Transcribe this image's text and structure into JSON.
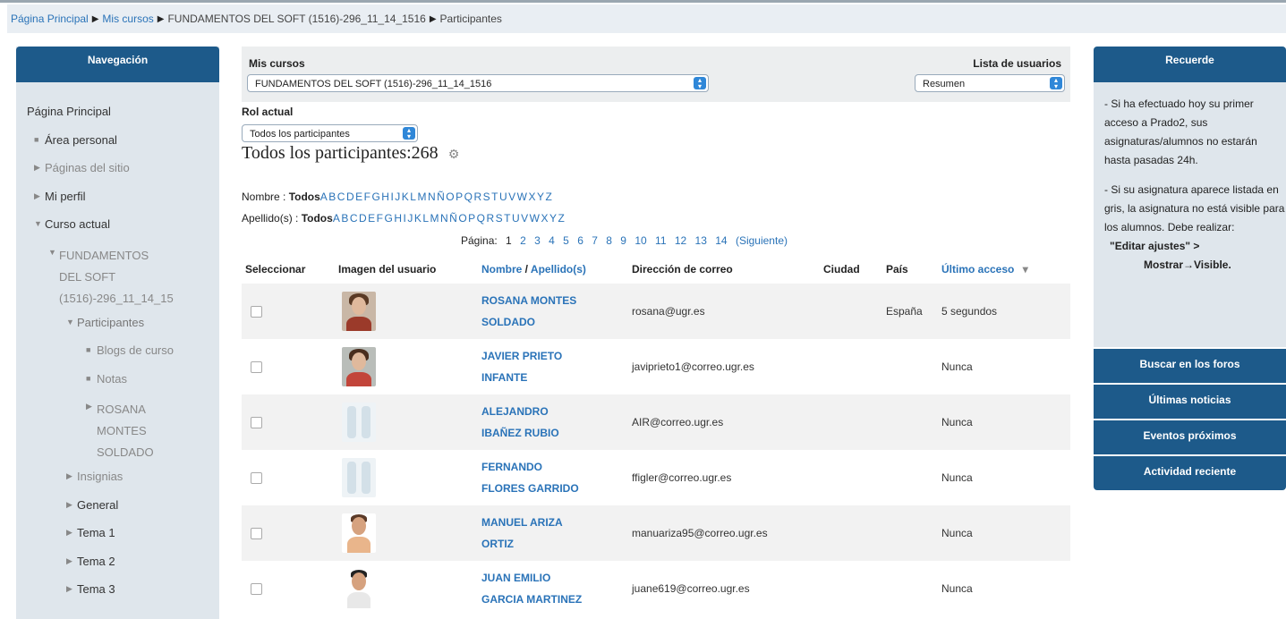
{
  "breadcrumb": {
    "items": [
      "Página Principal",
      "Mis cursos",
      "FUNDAMENTOS DEL SOFT (1516)-296_11_14_1516",
      "Participantes"
    ]
  },
  "navigation": {
    "header": "Navegación",
    "home": "Página Principal",
    "items": {
      "area_personal": "Área personal",
      "paginas_sitio": "Páginas del sitio",
      "mi_perfil": "Mi perfil",
      "curso_actual": "Curso actual",
      "course_line1": "FUNDAMENTOS",
      "course_line2": "DEL SOFT",
      "course_line3": "(1516)-296_11_14_15",
      "participantes": "Participantes",
      "blogs": "Blogs de curso",
      "notas": "Notas",
      "rosana_line1": "ROSANA",
      "rosana_line2": "MONTES",
      "rosana_line3": "SOLDADO",
      "insignias": "Insignias",
      "general": "General",
      "tema1": "Tema 1",
      "tema2": "Tema 2",
      "tema3": "Tema 3"
    }
  },
  "controls": {
    "mis_cursos_label": "Mis cursos",
    "mis_cursos_value": "FUNDAMENTOS DEL SOFT (1516)-296_11_14_1516",
    "lista_label": "Lista de usuarios",
    "lista_value": "Resumen",
    "rol_label": "Rol actual",
    "rol_value": "Todos los participantes"
  },
  "participants": {
    "heading": "Todos los participantes:268",
    "nombre_label": "Nombre : ",
    "apellido_label": "Apellido(s) : ",
    "todos": "Todos",
    "letters": "ABCDEFGHIJKLMNÑOPQRSTUVWXYZ",
    "pagina_label": "Página:",
    "current_page": "1",
    "pages": [
      "2",
      "3",
      "4",
      "5",
      "6",
      "7",
      "8",
      "9",
      "10",
      "11",
      "12",
      "13",
      "14"
    ],
    "siguiente": "(Siguiente)"
  },
  "table": {
    "headers": {
      "seleccionar": "Seleccionar",
      "imagen": "Imagen del usuario",
      "nombre": "Nombre",
      "slash": " / ",
      "apellido": "Apellido(s)",
      "correo": "Dirección de correo",
      "ciudad": "Ciudad",
      "pais": "País",
      "ultimo": "Último acceso",
      "sort_icon": "▾"
    },
    "rows": [
      {
        "name1": "ROSANA MONTES",
        "name2": "SOLDADO",
        "email": "rosana@ugr.es",
        "pais": "España",
        "acceso": "5 segundos"
      },
      {
        "name1": "JAVIER PRIETO",
        "name2": "INFANTE",
        "email": "javiprieto1@correo.ugr.es",
        "pais": "",
        "acceso": "Nunca"
      },
      {
        "name1": "ALEJANDRO",
        "name2": "IBAÑEZ RUBIO",
        "email": "AIR@correo.ugr.es",
        "pais": "",
        "acceso": "Nunca"
      },
      {
        "name1": "FERNANDO",
        "name2": "FLORES GARRIDO",
        "email": "ffigler@correo.ugr.es",
        "pais": "",
        "acceso": "Nunca"
      },
      {
        "name1": "MANUEL ARIZA",
        "name2": "ORTIZ",
        "email": "manuariza95@correo.ugr.es",
        "pais": "",
        "acceso": "Nunca"
      },
      {
        "name1": "JUAN EMILIO",
        "name2": "GARCIA MARTINEZ",
        "email": "juane619@correo.ugr.es",
        "pais": "",
        "acceso": "Nunca"
      }
    ]
  },
  "recuerde": {
    "header": "Recuerde",
    "p1": "- Si ha efectuado hoy su primer acceso a Prado2, sus asignaturas/alumnos no estarán hasta pasadas 24h.",
    "p2": "- Si su asignatura aparece listada en gris, la asignatura no está visible para los alumnos. Debe realizar:",
    "p3": "\"Editar ajustes\" >",
    "p4": "Mostrar→Visible."
  },
  "blocks": {
    "buscar": "Buscar en los foros",
    "noticias": "Últimas noticias",
    "eventos": "Eventos próximos",
    "actividad": "Actividad reciente"
  }
}
